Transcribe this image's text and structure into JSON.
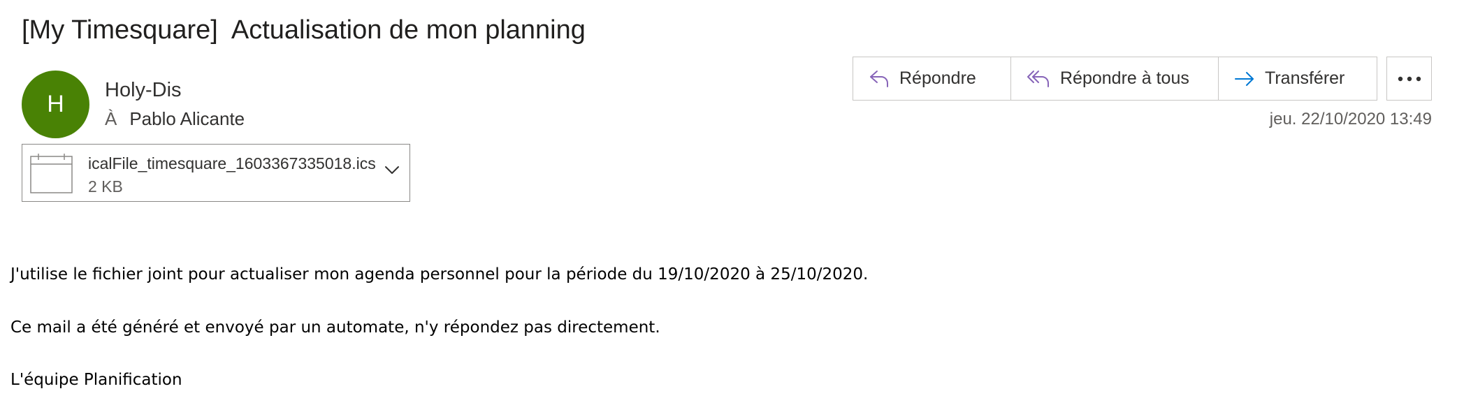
{
  "email": {
    "subject": "[My Timesquare]  Actualisation de mon planning",
    "avatar_initial": "H",
    "avatar_color": "#498205",
    "sender": "Holy-Dis",
    "to_label": "À",
    "to_name": "Pablo Alicante",
    "datetime": "jeu. 22/10/2020 13:49"
  },
  "actions": {
    "reply_label": "Répondre",
    "reply_all_label": "Répondre à tous",
    "forward_label": "Transférer",
    "more_icon": "ellipsis-icon",
    "reply_icon_color": "#8764b8",
    "forward_icon_color": "#0078d4"
  },
  "attachment": {
    "file_name": "icalFile_timesquare_1603367335018.ics",
    "file_size": "2 KB",
    "icon": "calendar-file-icon"
  },
  "body": {
    "line1": "J'utilise le fichier joint pour actualiser mon agenda personnel pour la période du 19/10/2020 à 25/10/2020.",
    "line2": "Ce mail a été généré et envoyé par un automate, n'y répondez pas directement.",
    "signature": "L'équipe Planification"
  }
}
